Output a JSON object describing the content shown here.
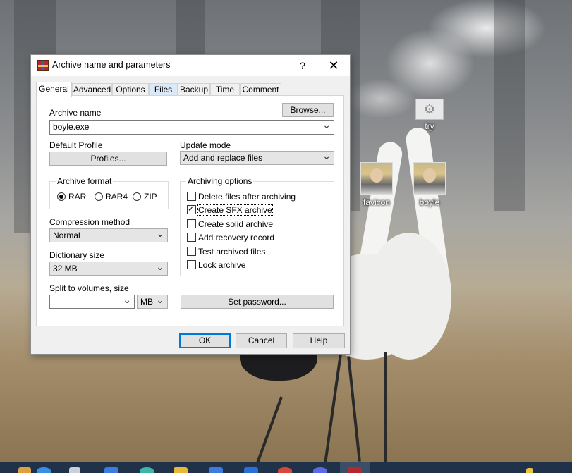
{
  "desktop": {
    "icons": [
      {
        "label": "try",
        "icon": "settings-gear-icon"
      },
      {
        "label": "favicon",
        "icon": "portrait-thumbnail"
      },
      {
        "label": "boyle",
        "icon": "portrait-thumbnail"
      }
    ]
  },
  "dialog": {
    "title": "Archive name and parameters",
    "help_glyph": "?",
    "close_glyph": "✕",
    "tabs": [
      {
        "label": "General"
      },
      {
        "label": "Advanced"
      },
      {
        "label": "Options"
      },
      {
        "label": "Files"
      },
      {
        "label": "Backup"
      },
      {
        "label": "Time"
      },
      {
        "label": "Comment"
      }
    ],
    "archive_name": {
      "label": "Archive name",
      "value": "boyle.exe",
      "browse_label": "Browse..."
    },
    "default_profile": {
      "label": "Default Profile",
      "button_label": "Profiles..."
    },
    "update_mode": {
      "label": "Update mode",
      "value": "Add and replace files"
    },
    "archive_format": {
      "title": "Archive format",
      "options": [
        {
          "label": "RAR",
          "selected": true
        },
        {
          "label": "RAR4",
          "selected": false
        },
        {
          "label": "ZIP",
          "selected": false
        }
      ]
    },
    "compression_method": {
      "label": "Compression method",
      "value": "Normal"
    },
    "dictionary_size": {
      "label": "Dictionary size",
      "value": "32 MB"
    },
    "split_volumes": {
      "label": "Split to volumes, size",
      "value": "",
      "unit": "MB"
    },
    "archiving_options": {
      "title": "Archiving options",
      "items": [
        {
          "label": "Delete files after archiving",
          "checked": false
        },
        {
          "label": "Create SFX archive",
          "checked": true
        },
        {
          "label": "Create solid archive",
          "checked": false
        },
        {
          "label": "Add recovery record",
          "checked": false
        },
        {
          "label": "Test archived files",
          "checked": false
        },
        {
          "label": "Lock archive",
          "checked": false
        }
      ]
    },
    "set_password_label": "Set password...",
    "buttons": {
      "ok": "OK",
      "cancel": "Cancel",
      "help": "Help"
    }
  },
  "colors": {
    "accent": "#0078d7",
    "taskbar": "#20324a",
    "dialog_bg": "#f0f0f0"
  }
}
